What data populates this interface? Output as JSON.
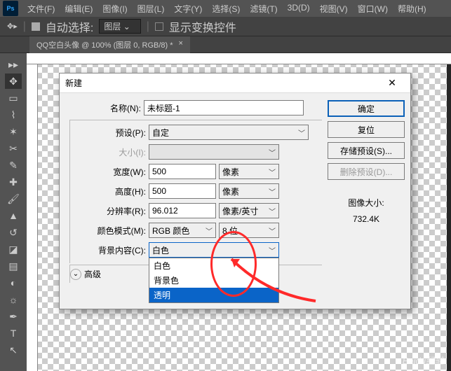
{
  "menu": [
    "文件(F)",
    "编辑(E)",
    "图像(I)",
    "图层(L)",
    "文字(Y)",
    "选择(S)",
    "滤镜(T)",
    "3D(D)",
    "视图(V)",
    "窗口(W)",
    "帮助(H)"
  ],
  "toolbar": {
    "autoSelect": "自动选择:",
    "layer": "图层",
    "showTransform": "显示变换控件"
  },
  "docTab": {
    "title": "QQ空白头像 @ 100% (图层 0, RGB/8) *",
    "close": "×"
  },
  "dialog": {
    "title": "新建",
    "name_lbl": "名称(N):",
    "name_val": "未标题-1",
    "preset_lbl": "预设(P):",
    "preset_val": "自定",
    "size_lbl": "大小(I):",
    "width_lbl": "宽度(W):",
    "width_val": "500",
    "width_unit": "像素",
    "height_lbl": "高度(H):",
    "height_val": "500",
    "height_unit": "像素",
    "res_lbl": "分辨率(R):",
    "res_val": "96.012",
    "res_unit": "像素/英寸",
    "mode_lbl": "颜色模式(M):",
    "mode_val": "RGB 颜色",
    "mode_bits": "8 位",
    "bg_lbl": "背景内容(C):",
    "bg_val": "白色",
    "bg_options": [
      "白色",
      "背景色",
      "透明"
    ],
    "adv_lbl": "高级",
    "infoTitle": "图像大小:",
    "infoVal": "732.4K",
    "buttons": {
      "ok": "确定",
      "reset": "复位",
      "savePreset": "存储预设(S)...",
      "deletePreset": "删除预设(D)..."
    }
  },
  "watermark": "Baidu经验"
}
